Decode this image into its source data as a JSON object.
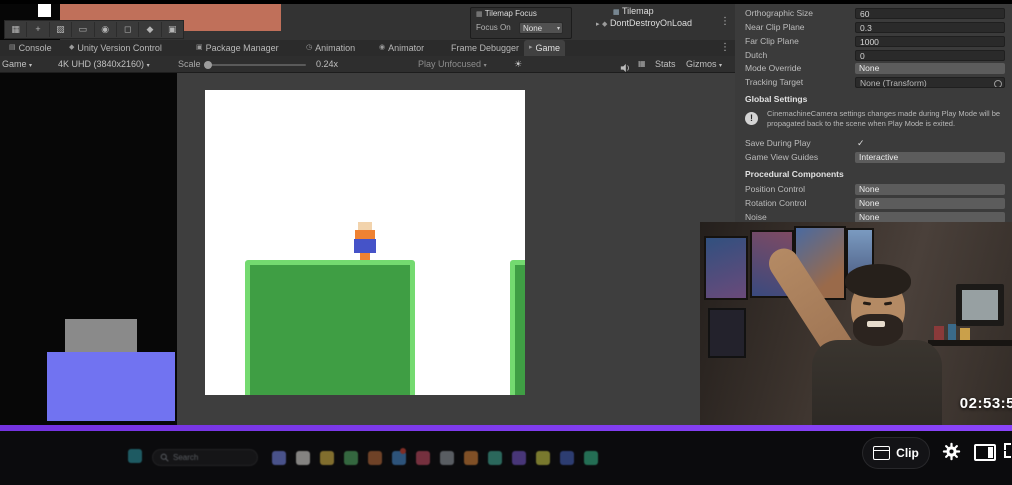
{
  "unity": {
    "tile_toolbar": {
      "tools": [
        "select",
        "move",
        "brush",
        "box-fill",
        "picker",
        "eraser",
        "fill",
        "rotate"
      ]
    },
    "scene_overlay": {
      "tilemap_focus_label": "Tilemap Focus",
      "focus_on_label": "Focus On",
      "focus_on_value": "None",
      "hierarchy_items": [
        "Tilemap",
        "DontDestroyOnLoad"
      ]
    },
    "tabs": [
      {
        "label": "Console"
      },
      {
        "label": "Unity Version Control"
      },
      {
        "label": "Package Manager"
      },
      {
        "label": "Animation"
      },
      {
        "label": "Animator"
      },
      {
        "label": "Frame Debugger"
      },
      {
        "label": "Game"
      }
    ],
    "game_toolbar": {
      "display": "Game",
      "resolution": "4K UHD (3840x2160)",
      "scale_label": "Scale",
      "scale_value": "0.24x",
      "play_mode": "Play Unfocused",
      "stats_label": "Stats",
      "gizmos_label": "Gizmos"
    },
    "inspector": {
      "orthographic_size": {
        "label": "Orthographic Size",
        "value": "60"
      },
      "near_clip": {
        "label": "Near Clip Plane",
        "value": "0.3"
      },
      "far_clip": {
        "label": "Far Clip Plane",
        "value": "1000"
      },
      "dutch": {
        "label": "Dutch",
        "value": "0"
      },
      "mode_override": {
        "label": "Mode Override",
        "value": "None"
      },
      "tracking_target": {
        "label": "Tracking Target",
        "value": "None (Transform)"
      },
      "global_settings_header": "Global Settings",
      "warning_text": "CinemachineCamera settings changes made during Play Mode will be propagated back to the scene when Play Mode is exited.",
      "save_during_play": {
        "label": "Save During Play",
        "value": "✓"
      },
      "game_view_guides": {
        "label": "Game View Guides",
        "value": "Interactive"
      },
      "procedural_header": "Procedural Components",
      "position_control": {
        "label": "Position Control",
        "value": "None"
      },
      "rotation_control": {
        "label": "Rotation Control",
        "value": "None"
      },
      "noise": {
        "label": "Noise",
        "value": "None"
      }
    }
  },
  "stream": {
    "timestamp": "02:53:5",
    "clip_button_label": "Clip"
  },
  "taskbar": {
    "search_label": "Search",
    "icon_colors": [
      "#7d8cf0",
      "#e8e6e0",
      "#e3c04a",
      "#57b368",
      "#c2703d",
      "#4a8fd4",
      "#cc4f66",
      "#9aa0a8",
      "#e08a3c",
      "#46b49e",
      "#7a5ad0",
      "#d4d44a",
      "#4a66c4",
      "#3ac08e"
    ]
  },
  "colors": {
    "seekbar_purple": "#7e3ff2",
    "platform_green_fill": "#3f9e44",
    "platform_green_border": "#74da70",
    "player_box_blue": "#7173f1",
    "player_box_gray": "#8a8a8a",
    "scene_background_orange": "#c0705a",
    "character_orange": "#ef8232",
    "character_blue": "#4553c8",
    "character_cream": "#f2d3ac"
  }
}
